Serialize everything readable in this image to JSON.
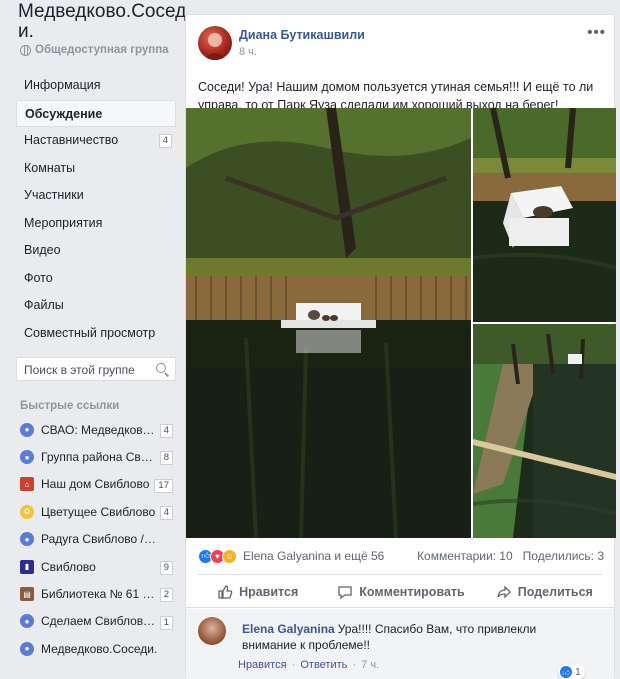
{
  "group": {
    "title": "Медведково.Сосед и.",
    "type": "Общедоступная группа"
  },
  "nav": [
    {
      "label": "Информация"
    },
    {
      "label": "Обсуждение",
      "active": true
    },
    {
      "label": "Наставничество",
      "badge": "4"
    },
    {
      "label": "Комнаты"
    },
    {
      "label": "Участники"
    },
    {
      "label": "Мероприятия"
    },
    {
      "label": "Видео"
    },
    {
      "label": "Фото"
    },
    {
      "label": "Файлы"
    },
    {
      "label": "Совместный просмотр"
    }
  ],
  "search": {
    "placeholder": "Поиск в этой группе"
  },
  "quick_links": {
    "title": "Быстрые ссылки",
    "items": [
      {
        "label": "СВАО: Медведково,...",
        "badge": "4",
        "icon": "group-icon",
        "color": "#5b7bd5"
      },
      {
        "label": "Группа района Свибл...",
        "badge": "8",
        "icon": "group-icon",
        "color": "#5b7bd5"
      },
      {
        "label": "Наш дом Свиблово",
        "badge": "17",
        "icon": "house-icon",
        "color": "#c9412f"
      },
      {
        "label": "Цветущее Свиблово",
        "badge": "4",
        "icon": "flower-icon",
        "color": "#f3c33c"
      },
      {
        "label": "Радуга Свиблово /Кра...",
        "icon": "group-icon",
        "color": "#5b7bd5"
      },
      {
        "label": "Свиблово",
        "badge": "9",
        "icon": "logo-icon",
        "color": "#2d2d8c"
      },
      {
        "label": "Библиотека № 61 н...",
        "badge": "2",
        "icon": "book-icon",
        "color": "#8a5a3c"
      },
      {
        "label": "Сделаем Свиблово ...",
        "badge": "1",
        "icon": "group-icon",
        "color": "#5b7bd5"
      },
      {
        "label": "Медведково.Соседи.",
        "icon": "group-icon",
        "color": "#5b7bd5"
      }
    ]
  },
  "post": {
    "author": "Диана Бутикашвили",
    "time": "8 ч.",
    "more": "•••",
    "text": "Соседи! Ура! Нашим домом пользуется утиная семья!!! И ещё то ли управа, то от Парк Яуза сделали им хороший выход на берег! Спасибо!",
    "reactions_names": "Elena Galyanina и ещё 56",
    "comments_count": "Комментарии: 10",
    "shares_count": "Поделились: 3"
  },
  "actions": {
    "like": "Нравится",
    "comment": "Комментировать",
    "share": "Поделиться"
  },
  "comment": {
    "author": "Elena Galyanina",
    "text": "Ура!!!! Спасибо Вам, что привлекли внимание к проблеме!!",
    "like": "Нравится",
    "reply": "Ответить",
    "sep": "·",
    "time": "7 ч.",
    "likes": "1"
  },
  "colors": {
    "link": "#385898",
    "like_blue": "#2078f4",
    "background": "#e9ebee"
  }
}
